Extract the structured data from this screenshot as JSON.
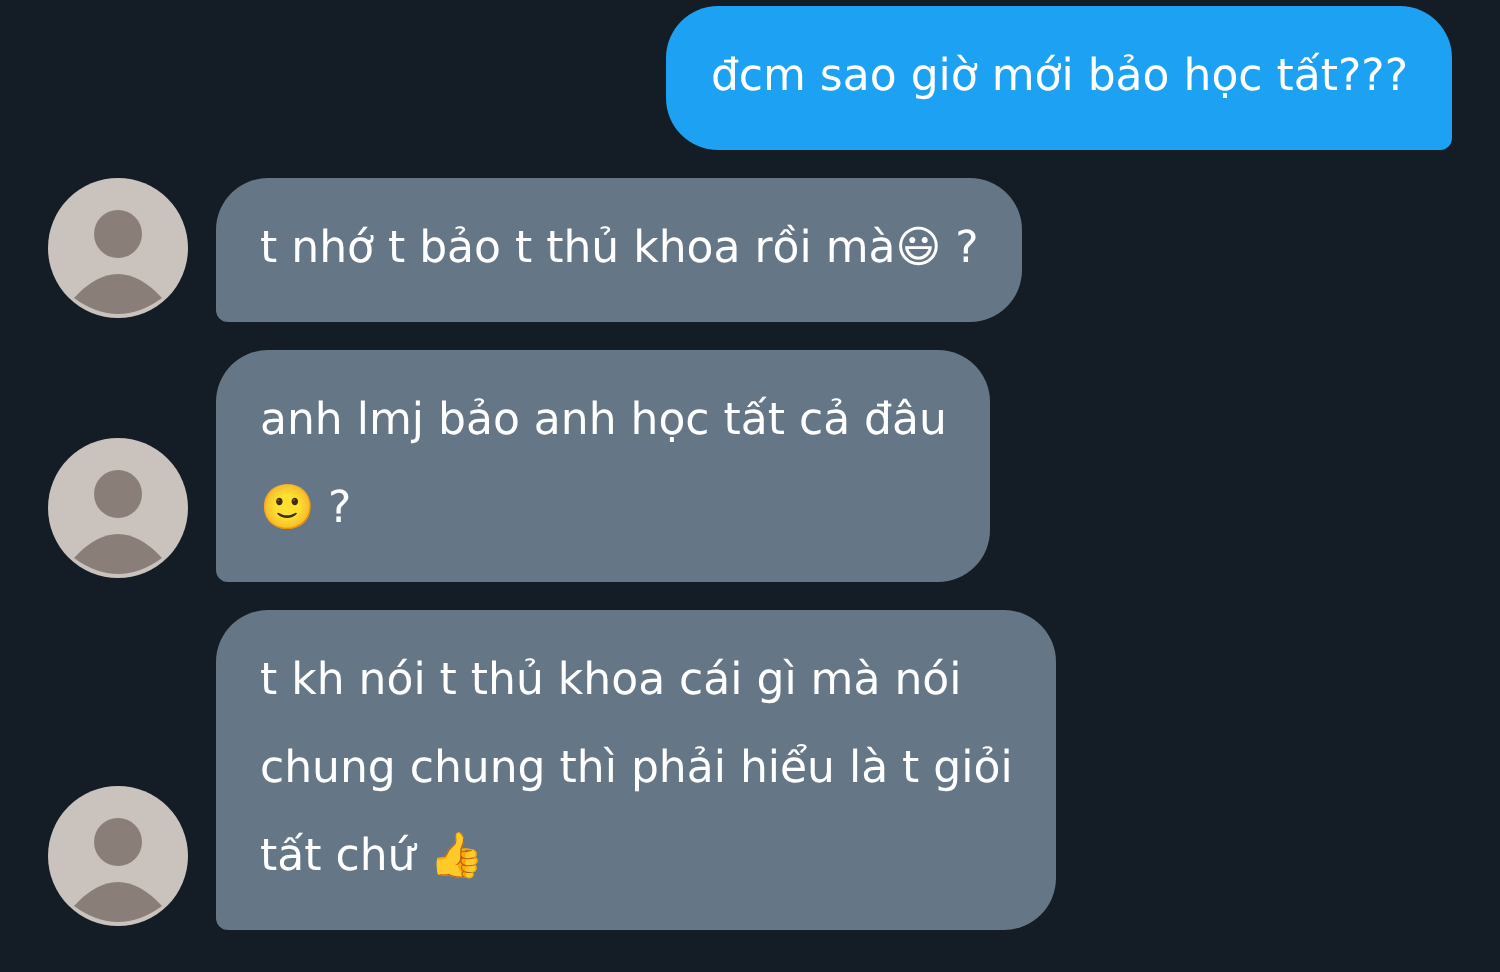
{
  "messages": [
    {
      "kind": "sent",
      "text": "đcm sao giờ mới bảo học tất???"
    },
    {
      "kind": "received",
      "text": "t nhớ t bảo t thủ khoa rồi mà😃 ?"
    },
    {
      "kind": "received",
      "text": "anh lmj bảo anh học tất cả đâu\n🙂 ?"
    },
    {
      "kind": "received",
      "text": "t kh nói t thủ khoa cái gì mà nói\nchung chung thì phải hiểu là t giỏi\ntất chứ 👍"
    }
  ]
}
